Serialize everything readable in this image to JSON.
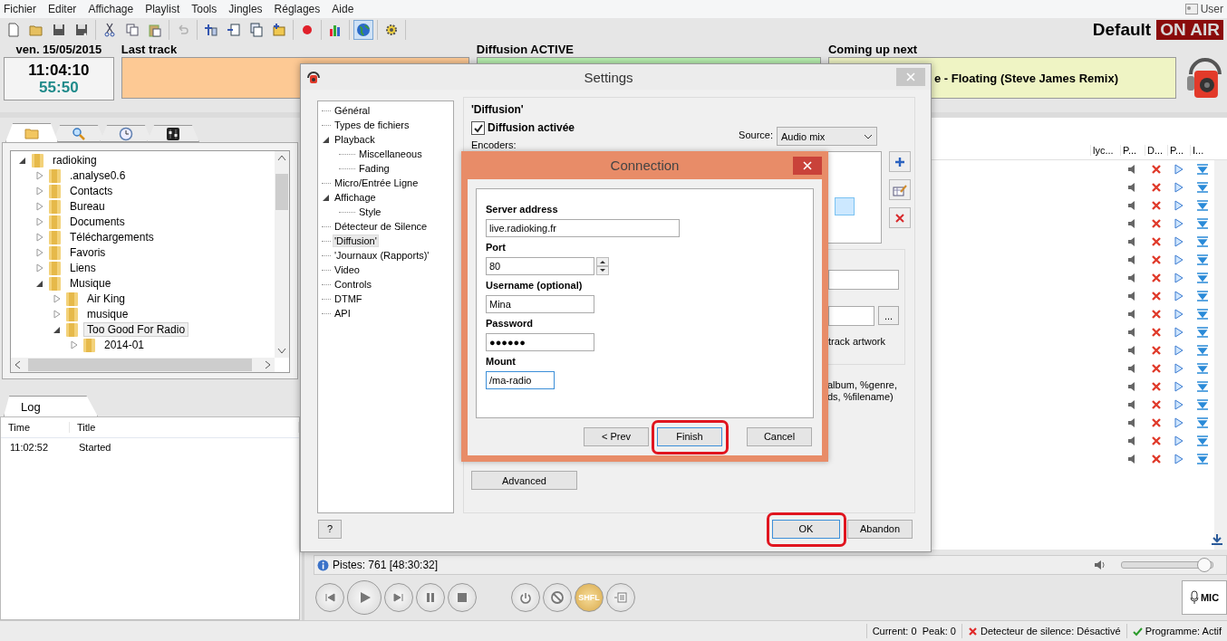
{
  "menu": {
    "items": [
      "Fichier",
      "Editer",
      "Affichage",
      "Playlist",
      "Tools",
      "Jingles",
      "Réglages",
      "Aide"
    ],
    "user": "User"
  },
  "toolbar": [
    {
      "buttons": [
        {
          "kind": "new",
          "pressed": false,
          "disabled": false
        },
        {
          "kind": "open",
          "pressed": false,
          "disabled": false
        },
        {
          "kind": "save",
          "pressed": false,
          "disabled": false
        },
        {
          "kind": "save-all",
          "pressed": false,
          "disabled": false
        }
      ]
    },
    {
      "buttons": [
        {
          "kind": "cut",
          "pressed": false,
          "disabled": false
        },
        {
          "kind": "copy",
          "pressed": false,
          "disabled": false
        },
        {
          "kind": "paste",
          "pressed": false,
          "disabled": false
        }
      ]
    },
    {
      "buttons": [
        {
          "kind": "undo",
          "pressed": false,
          "disabled": true
        }
      ]
    },
    {
      "buttons": [
        {
          "kind": "add",
          "pressed": false,
          "disabled": false
        },
        {
          "kind": "insert",
          "pressed": false,
          "disabled": false
        },
        {
          "kind": "import",
          "pressed": false,
          "disabled": false
        },
        {
          "kind": "folder-add",
          "pressed": false,
          "disabled": false
        }
      ]
    },
    {
      "buttons": [
        {
          "kind": "record",
          "pressed": false,
          "disabled": false
        }
      ]
    },
    {
      "buttons": [
        {
          "kind": "chart",
          "pressed": false,
          "disabled": false
        }
      ]
    },
    {
      "buttons": [
        {
          "kind": "globe",
          "pressed": true,
          "disabled": false
        }
      ]
    },
    {
      "buttons": [
        {
          "kind": "gear",
          "pressed": false,
          "disabled": false
        }
      ]
    }
  ],
  "profile": {
    "name": "Default",
    "on_air": "ON AIR"
  },
  "clock": {
    "date": "ven. 15/05/2015",
    "time": "11:04:10",
    "countdown": "55:50"
  },
  "last_track": {
    "label": "Last track"
  },
  "diffusion": {
    "label": "Diffusion ACTIVE"
  },
  "coming_up": {
    "label": "Coming up next",
    "value": "e - Floating (Steve James Remix)"
  },
  "browser": {
    "tabs": [
      {
        "kind": "folder",
        "selected": true
      },
      {
        "kind": "search",
        "selected": false
      },
      {
        "kind": "clock",
        "selected": false
      },
      {
        "kind": "mixer",
        "selected": false
      }
    ],
    "tree": [
      {
        "label": "radioking",
        "expanded": true,
        "selected": false,
        "children": [
          {
            "label": ".analyse0.6",
            "expanded": false,
            "selected": false
          },
          {
            "label": "Contacts",
            "expanded": false,
            "selected": false
          },
          {
            "label": "Bureau",
            "expanded": false,
            "selected": false
          },
          {
            "label": "Documents",
            "expanded": false,
            "selected": false
          },
          {
            "label": "Téléchargements",
            "expanded": false,
            "selected": false
          },
          {
            "label": "Favoris",
            "expanded": false,
            "selected": false
          },
          {
            "label": "Liens",
            "expanded": false,
            "selected": false
          },
          {
            "label": "Musique",
            "expanded": true,
            "selected": false,
            "children": [
              {
                "label": "Air King",
                "expanded": false,
                "selected": false
              },
              {
                "label": "musique",
                "expanded": false,
                "selected": false
              },
              {
                "label": "Too Good For Radio",
                "expanded": true,
                "selected": true,
                "children": [
                  {
                    "label": "2014-01",
                    "expanded": false,
                    "selected": false
                  }
                ]
              }
            ]
          }
        ]
      }
    ]
  },
  "log": {
    "tab": "Log",
    "columns": [
      "Time",
      "Title"
    ],
    "rows": [
      [
        "11:02:52",
        "Started"
      ]
    ]
  },
  "playlist": {
    "columns": [
      "lyc...",
      "P...",
      "D...",
      "P...",
      "I..."
    ],
    "rows": [
      {
        "kind": "track"
      },
      {
        "kind": "track"
      },
      {
        "kind": "track"
      },
      {
        "kind": "track"
      },
      {
        "kind": "track"
      },
      {
        "kind": "track"
      },
      {
        "kind": "track"
      },
      {
        "kind": "track"
      },
      {
        "kind": "track"
      },
      {
        "kind": "track"
      },
      {
        "kind": "track"
      },
      {
        "kind": "track"
      },
      {
        "kind": "track"
      },
      {
        "kind": "track"
      },
      {
        "kind": "track"
      },
      {
        "kind": "track"
      },
      {
        "kind": "track"
      }
    ]
  },
  "info": {
    "text": "Pistes: 761 [48:30:32]",
    "volume": {
      "level": 0.98
    }
  },
  "transport": [
    {
      "kind": "prev",
      "on": false
    },
    {
      "kind": "play",
      "on": false
    },
    {
      "kind": "next",
      "on": false
    },
    {
      "kind": "pause",
      "on": false
    },
    {
      "kind": "stop",
      "on": false
    },
    {
      "kind": "loop",
      "on": false
    },
    {
      "kind": "block",
      "on": false
    },
    {
      "kind": "shuffle",
      "label": "SHFL",
      "on": true
    },
    {
      "kind": "list",
      "on": false
    }
  ],
  "mic": "MIC",
  "status": [
    {
      "kind": "plain",
      "text": "Current: 0  Peak: 0"
    },
    {
      "kind": "error",
      "text": "Detecteur de silence: Désactivé"
    },
    {
      "kind": "ok",
      "text": "Programme: Actif"
    }
  ],
  "settings": {
    "title": "Settings",
    "nav": [
      {
        "label": "Général",
        "selected": false
      },
      {
        "label": "Types de fichiers",
        "selected": false
      },
      {
        "label": "Playback",
        "expanded": true,
        "selected": false,
        "children": [
          {
            "label": "Miscellaneous",
            "selected": false
          },
          {
            "label": "Fading",
            "selected": false
          }
        ]
      },
      {
        "label": "Micro/Entrée Ligne",
        "selected": false
      },
      {
        "label": "Affichage",
        "expanded": true,
        "selected": false,
        "children": [
          {
            "label": "Style",
            "selected": false
          }
        ]
      },
      {
        "label": "Détecteur de Silence",
        "selected": false
      },
      {
        "label": "'Diffusion'",
        "selected": true
      },
      {
        "label": "'Journaux (Rapports)'",
        "selected": false
      },
      {
        "label": "Video",
        "selected": false
      },
      {
        "label": "Controls",
        "selected": false
      },
      {
        "label": "DTMF",
        "selected": false
      },
      {
        "label": "API",
        "selected": false
      }
    ],
    "group_title": "'Diffusion'",
    "enabled": {
      "label": "Diffusion activée",
      "checked": true
    },
    "source": {
      "label": "Source:",
      "value": "Audio mix"
    },
    "encoders_label": "Encoders:",
    "artwork_text": "track artwork",
    "help_lines": [
      "album, %genre,",
      "ds, %filename)"
    ],
    "browse": "...",
    "advanced": "Advanced",
    "help": "?",
    "ok": "OK",
    "cancel": "Abandon"
  },
  "connection": {
    "title": "Connection",
    "fields": [
      {
        "label": "Server address",
        "value": "live.radioking.fr",
        "kind": "text"
      },
      {
        "label": "Port",
        "value": "80",
        "kind": "spin"
      },
      {
        "label": "Username (optional)",
        "value": "Mina",
        "kind": "text"
      },
      {
        "label": "Password",
        "value": "●●●●●●",
        "kind": "text"
      },
      {
        "label": "Mount",
        "value": "/ma-radio",
        "kind": "focused"
      }
    ],
    "buttons": [
      {
        "label": "< Prev",
        "highlighted": false
      },
      {
        "label": "Finish",
        "highlighted": true
      },
      {
        "label": "Cancel",
        "highlighted": false
      }
    ]
  }
}
